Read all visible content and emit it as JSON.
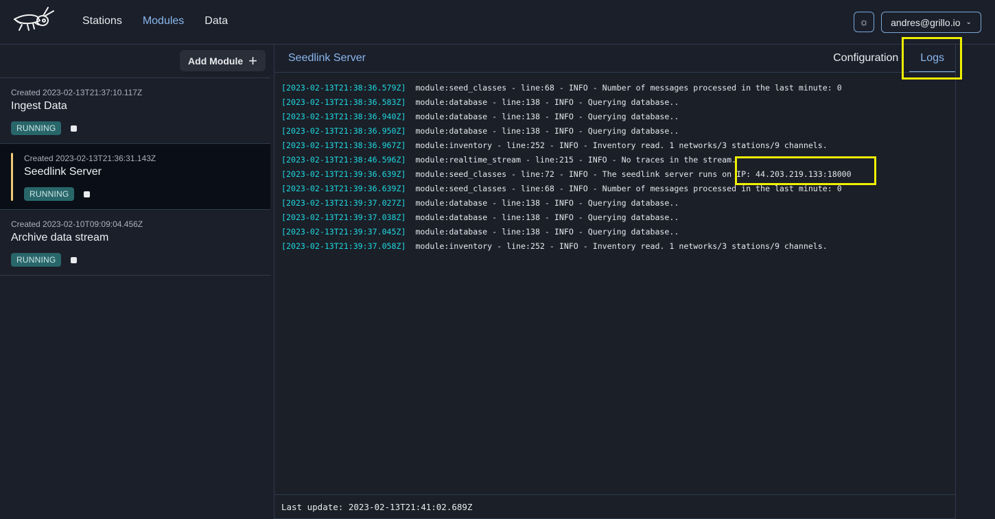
{
  "header": {
    "logo": "cricket-logo",
    "nav": [
      {
        "label": "Stations",
        "active": false
      },
      {
        "label": "Modules",
        "active": true
      },
      {
        "label": "Data",
        "active": false
      }
    ],
    "theme_icon": "☼",
    "user": "andres@grillo.io",
    "user_chevron": "⌄"
  },
  "sidebar": {
    "add_button": "Add Module",
    "add_icon": "+",
    "modules": [
      {
        "created": "Created 2023-02-13T21:37:10.117Z",
        "name": "Ingest Data",
        "status": "RUNNING",
        "selected": false
      },
      {
        "created": "Created 2023-02-13T21:36:31.143Z",
        "name": "Seedlink Server",
        "status": "RUNNING",
        "selected": true
      },
      {
        "created": "Created 2023-02-10T09:09:04.456Z",
        "name": "Archive data stream",
        "status": "RUNNING",
        "selected": false
      }
    ]
  },
  "main": {
    "title": "Seedlink Server",
    "tabs": [
      {
        "label": "Configuration",
        "active": false
      },
      {
        "label": "Logs",
        "active": true
      }
    ],
    "logs": [
      {
        "ts": "[2023-02-13T21:38:36.579Z]",
        "msg": "module:seed_classes - line:68 - INFO - Number of messages processed in the last minute: 0"
      },
      {
        "ts": "[2023-02-13T21:38:36.583Z]",
        "msg": "module:database - line:138 - INFO - Querying database.."
      },
      {
        "ts": "[2023-02-13T21:38:36.940Z]",
        "msg": "module:database - line:138 - INFO - Querying database.."
      },
      {
        "ts": "[2023-02-13T21:38:36.950Z]",
        "msg": "module:database - line:138 - INFO - Querying database.."
      },
      {
        "ts": "[2023-02-13T21:38:36.967Z]",
        "msg": "module:inventory - line:252 - INFO - Inventory read. 1 networks/3 stations/9 channels."
      },
      {
        "ts": "[2023-02-13T21:38:46.596Z]",
        "msg": "module:realtime_stream - line:215 - INFO - No traces in the stream."
      },
      {
        "ts": "[2023-02-13T21:39:36.639Z]",
        "msg": "module:seed_classes - line:72 - INFO - The seedlink server runs on IP: 44.203.219.133:18000"
      },
      {
        "ts": "[2023-02-13T21:39:36.639Z]",
        "msg": "module:seed_classes - line:68 - INFO - Number of messages processed in the last minute: 0"
      },
      {
        "ts": "[2023-02-13T21:39:37.027Z]",
        "msg": "module:database - line:138 - INFO - Querying database.."
      },
      {
        "ts": "[2023-02-13T21:39:37.038Z]",
        "msg": "module:database - line:138 - INFO - Querying database.."
      },
      {
        "ts": "[2023-02-13T21:39:37.045Z]",
        "msg": "module:database - line:138 - INFO - Querying database.."
      },
      {
        "ts": "[2023-02-13T21:39:37.058Z]",
        "msg": "module:inventory - line:252 - INFO - Inventory read. 1 networks/3 stations/9 channels."
      }
    ],
    "footer": "Last update: 2023-02-13T21:41:02.689Z"
  },
  "colors": {
    "accent": "#8ab8ee",
    "timestamp": "#1ed8e0",
    "running_badge": "#28666a",
    "selected_marker": "#f2c97a",
    "annotation": "#f0f000"
  }
}
